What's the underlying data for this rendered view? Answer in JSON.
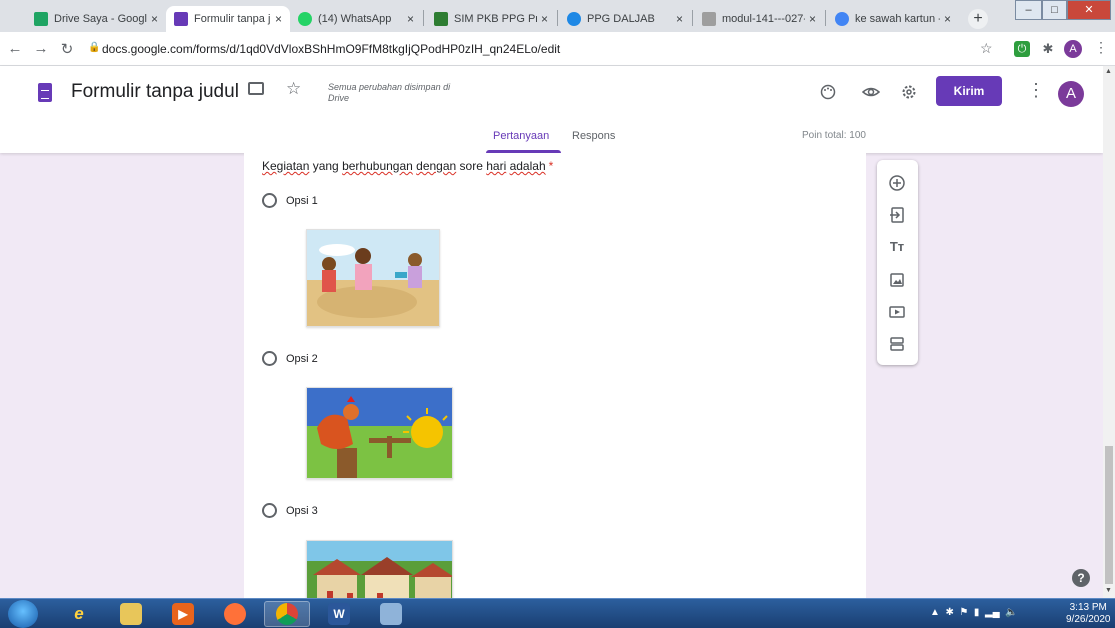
{
  "browser": {
    "tabs": [
      {
        "label": "Drive Saya - Google Drive",
        "icon": "google-drive-icon",
        "color": "#1fa463"
      },
      {
        "label": "Formulir tanpa judul - Google Formulir",
        "icon": "google-forms-icon",
        "color": "#673ab7"
      },
      {
        "label": "(14) WhatsApp",
        "icon": "whatsapp-icon",
        "color": "#25d366"
      },
      {
        "label": "SIM PKB PPG Prajabatan",
        "icon": "sim-pkb-icon",
        "color": "#2e7d32"
      },
      {
        "label": "PPG DALJAB",
        "icon": "ppg-daljab-icon",
        "color": "#1e88e5"
      },
      {
        "label": "modul-141---027-",
        "icon": "document-icon",
        "color": "#9e9e9e"
      },
      {
        "label": "ke sawah kartun - Google",
        "icon": "google-icon",
        "color": "#4285f4"
      }
    ],
    "close_glyph": "×",
    "new_tab_glyph": "+",
    "url": "docs.google.com/forms/d/1qd0VdVloxBShHmO9FfM8tkgIjQPodHP0zIH_qn24ELo/edit",
    "profile_letter": "A"
  },
  "form": {
    "title": "Formulir tanpa judul",
    "save_status": "Semua perubahan disimpan di Drive",
    "send_label": "Kirim",
    "profile_letter": "A",
    "tabs": {
      "questions": "Pertanyaan",
      "responses": "Respons"
    },
    "points_total": "Poin total: 100",
    "question": {
      "words": [
        "Kegiatan",
        " yang ",
        "berhubungan",
        " ",
        "dengan",
        " sore ",
        "hari",
        " ",
        "adalah"
      ],
      "required_mark": "*"
    },
    "options": [
      {
        "label": "Opsi 1"
      },
      {
        "label": "Opsi 2"
      },
      {
        "label": "Opsi 3"
      }
    ]
  },
  "toolbar": {
    "items": [
      "add-question",
      "import-questions",
      "add-title-description",
      "add-image",
      "add-video",
      "add-section"
    ]
  },
  "taskbar": {
    "clock_time": "3:13 PM",
    "clock_date": "9/26/2020"
  },
  "colors": {
    "brand": "#673ab7",
    "page_bg": "#f1e9f5",
    "required": "#d93025"
  }
}
